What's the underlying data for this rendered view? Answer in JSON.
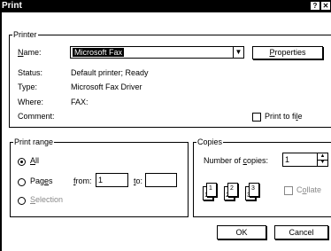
{
  "window": {
    "title": "Print",
    "help_label": "?",
    "close_label": "✕"
  },
  "printer": {
    "group_label": "Printer",
    "name_label": "Name:",
    "name_value": "Microsoft Fax",
    "properties_label": "Properties",
    "status_label": "Status:",
    "status_value": "Default printer; Ready",
    "type_label": "Type:",
    "type_value": "Microsoft Fax Driver",
    "where_label": "Where:",
    "where_value": "FAX:",
    "comment_label": "Comment:",
    "print_to_file_label": "Print to file",
    "print_to_file_checked": false
  },
  "print_range": {
    "group_label": "Print range",
    "all_label": "All",
    "all_selected": true,
    "pages_label": "Pages",
    "from_label": "from:",
    "from_value": "1",
    "to_label": "to:",
    "to_value": "",
    "selection_label": "Selection"
  },
  "copies": {
    "group_label": "Copies",
    "number_label": "Number of copies:",
    "number_value": "1",
    "collate_label": "Collate",
    "collate_checked": false,
    "page_icons": [
      "1",
      "1",
      "2",
      "2",
      "3",
      "3"
    ]
  },
  "buttons": {
    "ok_label": "OK",
    "cancel_label": "Cancel"
  }
}
